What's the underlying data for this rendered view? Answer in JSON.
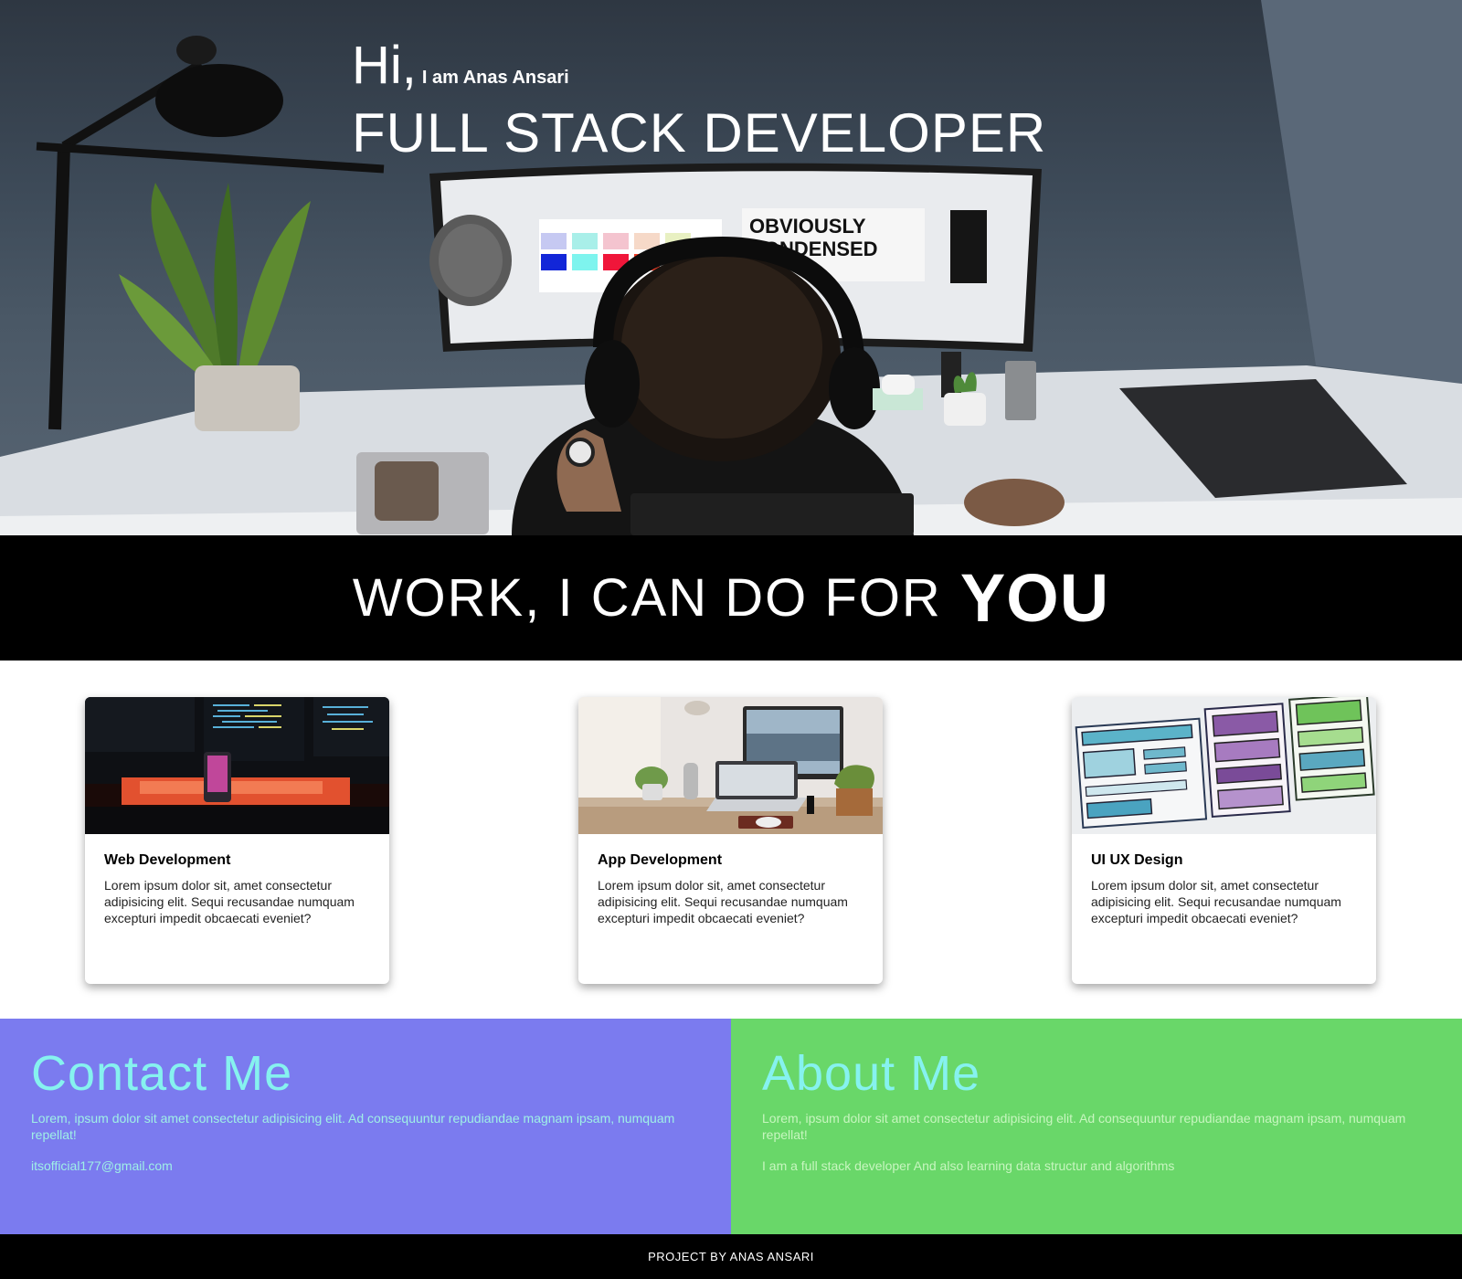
{
  "hero": {
    "greeting": "Hi,",
    "intro": "I am Anas Ansari",
    "role": "FULL STACK DEVELOPER",
    "monitor_text": [
      "OBVIOUSLY",
      "CONDENSED"
    ]
  },
  "work": {
    "heading": "WORK, I CAN DO FOR",
    "emphasis": "YOU"
  },
  "services": [
    {
      "title": "Web Development",
      "text": "Lorem ipsum dolor sit, amet consectetur adipisicing elit. Sequi recusandae numquam excepturi impedit obcaecati eveniet?"
    },
    {
      "title": "App Development",
      "text": "Lorem ipsum dolor sit, amet consectetur adipisicing elit. Sequi recusandae numquam excepturi impedit obcaecati eveniet?"
    },
    {
      "title": "UI UX Design",
      "text": "Lorem ipsum dolor sit, amet consectetur adipisicing elit. Sequi recusandae numquam excepturi impedit obcaecati eveniet?"
    }
  ],
  "contact": {
    "title": "Contact Me",
    "text": "Lorem, ipsum dolor sit amet consectetur adipisicing elit. Ad consequuntur repudiandae magnam ipsam, numquam repellat!",
    "email": "itsofficial177@gmail.com"
  },
  "about": {
    "title": "About Me",
    "text": "Lorem, ipsum dolor sit amet consectetur adipisicing elit. Ad consequuntur repudiandae magnam ipsam, numquam repellat!",
    "bio": "I am a full stack developer And also learning data structur and algorithms"
  },
  "footer": {
    "text": "PROJECT BY ANAS ANSARI"
  },
  "colors": {
    "contact_bg": "#7b7bef",
    "about_bg": "#69d769",
    "panel_heading": "#86f2ef",
    "banner_bg": "#000000"
  }
}
